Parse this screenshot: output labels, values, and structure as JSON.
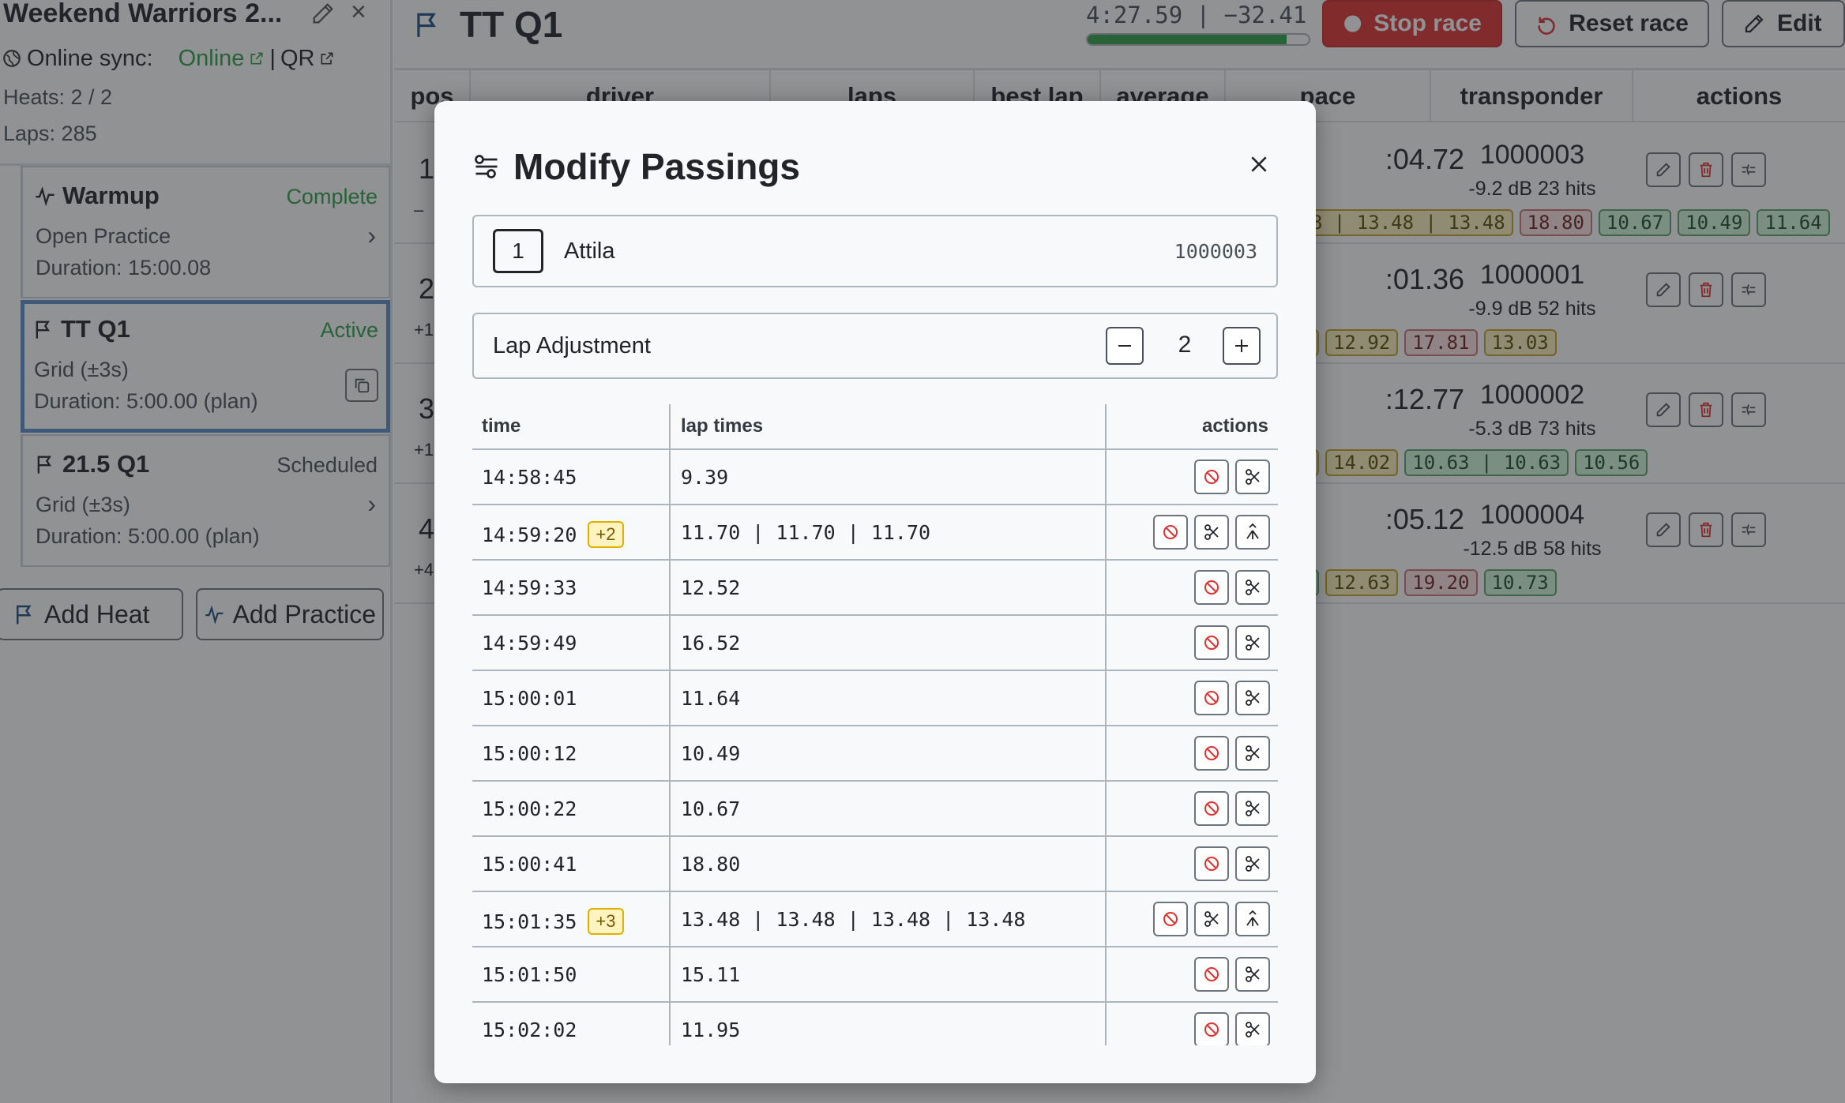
{
  "sidebar": {
    "event_title": "Weekend Warriors 2...",
    "sync_label": "Online sync:",
    "sync_status": "Online",
    "sync_separator": "|",
    "qr_label": "QR",
    "heats_stat": "Heats: 2 / 2",
    "laps_stat": "Laps: 285",
    "heats": [
      {
        "name": "Warmup",
        "status": "Complete",
        "line1": "Open Practice",
        "line2": "Duration: 15:00.08",
        "status_color": "#2f9e44"
      },
      {
        "name": "TT Q1",
        "status": "Active",
        "line1": "Grid (±3s)",
        "line2": "Duration: 5:00.00 (plan)",
        "status_color": "#2f9e44"
      },
      {
        "name": "21.5 Q1",
        "status": "Scheduled",
        "line1": "Grid (±3s)",
        "line2": "Duration: 5:00.00 (plan)",
        "status_color": "#495057"
      }
    ],
    "add_heat_label": "Add Heat",
    "add_practice_label": "Add Practice"
  },
  "main": {
    "race_title": "TT Q1",
    "timer_text": "4:27.59 | −32.41",
    "progress_fraction": 0.9,
    "stop_label": "Stop race",
    "reset_label": "Reset race",
    "edit_label": "Edit",
    "columns": [
      "pos",
      "driver",
      "laps",
      "best lap",
      "average",
      "pace",
      "transponder",
      "actions"
    ],
    "rows": [
      {
        "pos": "1",
        "pos_sub": "–",
        "pace": ":04.72",
        "transponder": "1000003",
        "signal": "-9.2 dB  23 hits",
        "chips": [
          {
            "text": "8 | 13.48 | 13.48",
            "kind": "y"
          },
          {
            "text": "18.80",
            "kind": "r"
          },
          {
            "text": "10.67",
            "kind": "g"
          },
          {
            "text": "10.49",
            "kind": "g"
          },
          {
            "text": "11.64",
            "kind": "g"
          }
        ]
      },
      {
        "pos": "2",
        "pos_sub": "+1",
        "pace": ":01.36",
        "transponder": "1000001",
        "signal": "-9.9 dB  52 hits",
        "chips": [
          {
            "text": "",
            "kind": "y"
          },
          {
            "text": "12.92",
            "kind": "y"
          },
          {
            "text": "17.81",
            "kind": "r"
          },
          {
            "text": "13.03",
            "kind": "y"
          }
        ]
      },
      {
        "pos": "3",
        "pos_sub": "+1",
        "pace": ":12.77",
        "transponder": "1000002",
        "signal": "-5.3 dB  73 hits",
        "chips": [
          {
            "text": "",
            "kind": "y"
          },
          {
            "text": "14.02",
            "kind": "y"
          },
          {
            "text": "10.63 | 10.63",
            "kind": "g"
          },
          {
            "text": "10.56",
            "kind": "g"
          }
        ]
      },
      {
        "pos": "4",
        "pos_sub": "+4.",
        "pace": ":05.12",
        "transponder": "1000004",
        "signal": "-12.5 dB  58 hits",
        "chips": [
          {
            "text": "",
            "kind": "g"
          },
          {
            "text": "12.63",
            "kind": "y"
          },
          {
            "text": "19.20",
            "kind": "r"
          },
          {
            "text": "10.73",
            "kind": "g"
          }
        ]
      }
    ]
  },
  "modal": {
    "title": "Modify Passings",
    "driver": {
      "number": "1",
      "name": "Attila",
      "transponder": "1000003"
    },
    "lap_adjustment": {
      "label": "Lap Adjustment",
      "value": "2"
    },
    "table_headers": {
      "time": "time",
      "lap_times": "lap times",
      "actions": "actions"
    },
    "passings": [
      {
        "time": "14:58:45",
        "badge": "",
        "lap_times": "9.39",
        "merge": false
      },
      {
        "time": "14:59:20",
        "badge": "+2",
        "lap_times": "11.70 | 11.70 | 11.70",
        "merge": true
      },
      {
        "time": "14:59:33",
        "badge": "",
        "lap_times": "12.52",
        "merge": false
      },
      {
        "time": "14:59:49",
        "badge": "",
        "lap_times": "16.52",
        "merge": false
      },
      {
        "time": "15:00:01",
        "badge": "",
        "lap_times": "11.64",
        "merge": false
      },
      {
        "time": "15:00:12",
        "badge": "",
        "lap_times": "10.49",
        "merge": false
      },
      {
        "time": "15:00:22",
        "badge": "",
        "lap_times": "10.67",
        "merge": false
      },
      {
        "time": "15:00:41",
        "badge": "",
        "lap_times": "18.80",
        "merge": false
      },
      {
        "time": "15:01:35",
        "badge": "+3",
        "lap_times": "13.48 | 13.48 | 13.48 | 13.48",
        "merge": true
      },
      {
        "time": "15:01:50",
        "badge": "",
        "lap_times": "15.11",
        "merge": false
      },
      {
        "time": "15:02:02",
        "badge": "",
        "lap_times": "11.95",
        "merge": false
      }
    ]
  },
  "icons": {
    "flag": "flag-icon",
    "pulse": "pulse-icon",
    "block": "block-icon",
    "scissors": "scissors-icon",
    "merge": "merge-icon"
  }
}
